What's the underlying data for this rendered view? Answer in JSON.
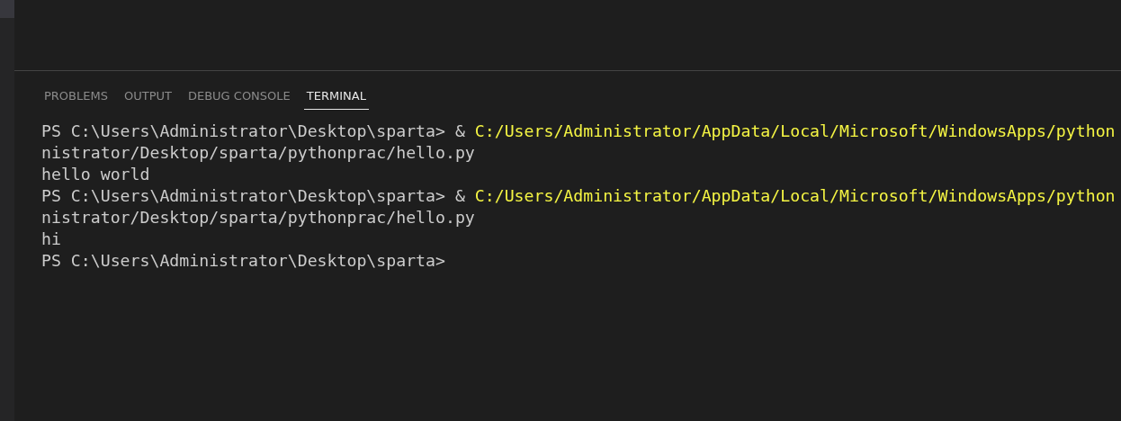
{
  "tabs": [
    {
      "label": "PROBLEMS",
      "selected": false
    },
    {
      "label": "OUTPUT",
      "selected": false
    },
    {
      "label": "DEBUG CONSOLE",
      "selected": false
    },
    {
      "label": "TERMINAL",
      "selected": true
    }
  ],
  "terminal": {
    "lines": [
      {
        "segments": [
          {
            "kind": "plain",
            "text": "PS C:\\Users\\Administrator\\Desktop\\sparta> & "
          },
          {
            "kind": "path",
            "text": "C:/Users/Administrator/AppData/Local/Microsoft/WindowsApps/python"
          }
        ]
      },
      {
        "segments": [
          {
            "kind": "plain",
            "text": "nistrator/Desktop/sparta/pythonprac/hello.py"
          }
        ]
      },
      {
        "segments": [
          {
            "kind": "plain",
            "text": "hello world"
          }
        ]
      },
      {
        "segments": [
          {
            "kind": "plain",
            "text": "PS C:\\Users\\Administrator\\Desktop\\sparta> & "
          },
          {
            "kind": "path",
            "text": "C:/Users/Administrator/AppData/Local/Microsoft/WindowsApps/python"
          }
        ]
      },
      {
        "segments": [
          {
            "kind": "plain",
            "text": "nistrator/Desktop/sparta/pythonprac/hello.py"
          }
        ]
      },
      {
        "segments": [
          {
            "kind": "plain",
            "text": "hi"
          }
        ]
      },
      {
        "segments": [
          {
            "kind": "plain",
            "text": "PS C:\\Users\\Administrator\\Desktop\\sparta>"
          }
        ]
      }
    ]
  }
}
